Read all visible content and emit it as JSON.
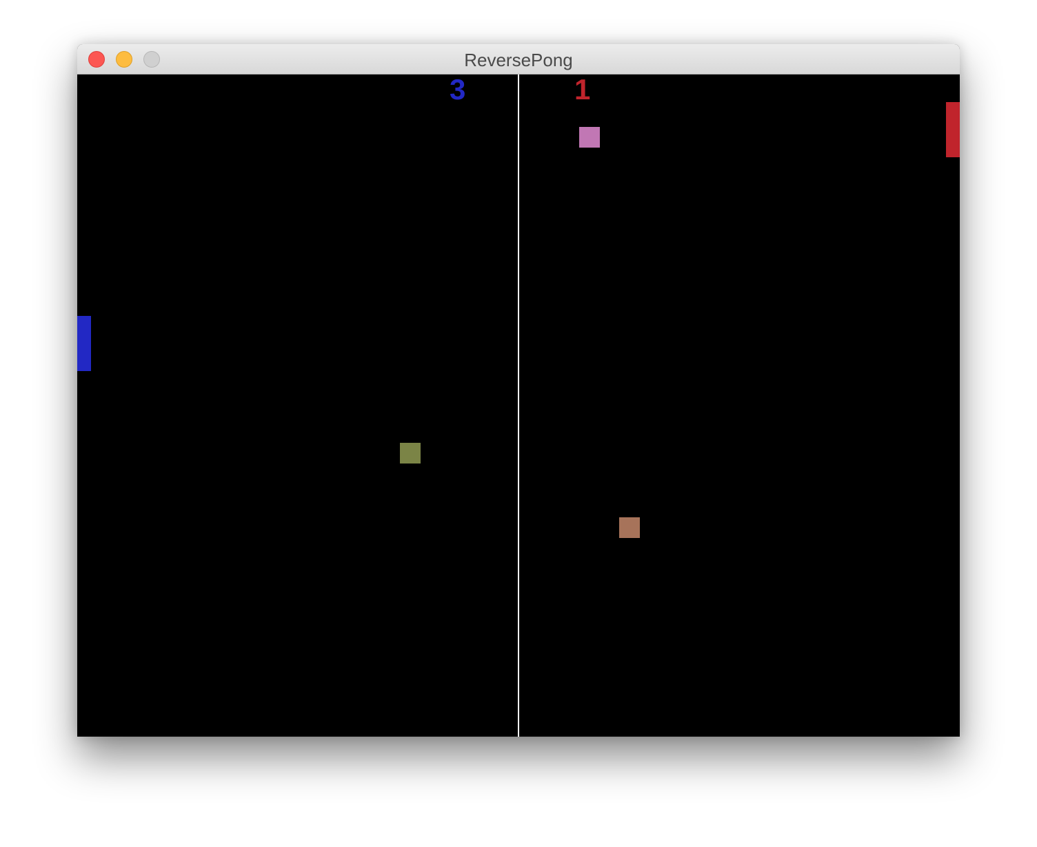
{
  "window": {
    "title": "ReversePong"
  },
  "game": {
    "score_left": "3",
    "score_right": "1",
    "colors": {
      "background": "#000000",
      "divider": "#ffffff",
      "left_player": "#2228c4",
      "right_player": "#c0242c",
      "ball_pink": "#c177b4",
      "ball_olive": "#7b8446",
      "ball_brown": "#a7735a"
    },
    "balls": [
      {
        "name": "pink-ball",
        "color": "#c177b4"
      },
      {
        "name": "olive-ball",
        "color": "#7b8446"
      },
      {
        "name": "brown-ball",
        "color": "#a7735a"
      }
    ]
  }
}
